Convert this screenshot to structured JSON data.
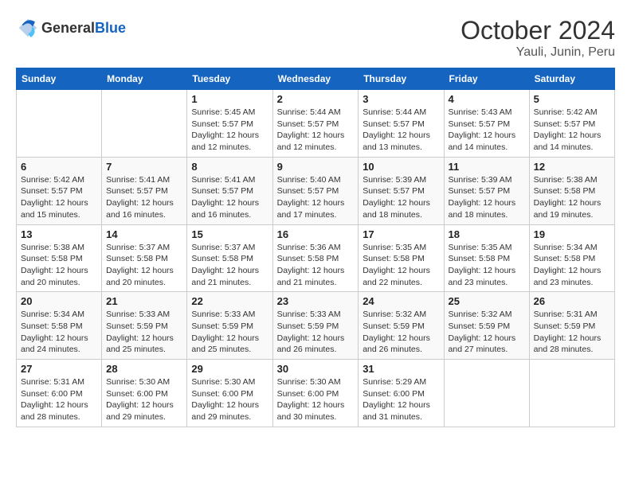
{
  "header": {
    "logo_general": "General",
    "logo_blue": "Blue",
    "month": "October 2024",
    "location": "Yauli, Junin, Peru"
  },
  "weekdays": [
    "Sunday",
    "Monday",
    "Tuesday",
    "Wednesday",
    "Thursday",
    "Friday",
    "Saturday"
  ],
  "weeks": [
    [
      {
        "day": "",
        "sunrise": "",
        "sunset": "",
        "daylight": ""
      },
      {
        "day": "",
        "sunrise": "",
        "sunset": "",
        "daylight": ""
      },
      {
        "day": "1",
        "sunrise": "Sunrise: 5:45 AM",
        "sunset": "Sunset: 5:57 PM",
        "daylight": "Daylight: 12 hours and 12 minutes."
      },
      {
        "day": "2",
        "sunrise": "Sunrise: 5:44 AM",
        "sunset": "Sunset: 5:57 PM",
        "daylight": "Daylight: 12 hours and 12 minutes."
      },
      {
        "day": "3",
        "sunrise": "Sunrise: 5:44 AM",
        "sunset": "Sunset: 5:57 PM",
        "daylight": "Daylight: 12 hours and 13 minutes."
      },
      {
        "day": "4",
        "sunrise": "Sunrise: 5:43 AM",
        "sunset": "Sunset: 5:57 PM",
        "daylight": "Daylight: 12 hours and 14 minutes."
      },
      {
        "day": "5",
        "sunrise": "Sunrise: 5:42 AM",
        "sunset": "Sunset: 5:57 PM",
        "daylight": "Daylight: 12 hours and 14 minutes."
      }
    ],
    [
      {
        "day": "6",
        "sunrise": "Sunrise: 5:42 AM",
        "sunset": "Sunset: 5:57 PM",
        "daylight": "Daylight: 12 hours and 15 minutes."
      },
      {
        "day": "7",
        "sunrise": "Sunrise: 5:41 AM",
        "sunset": "Sunset: 5:57 PM",
        "daylight": "Daylight: 12 hours and 16 minutes."
      },
      {
        "day": "8",
        "sunrise": "Sunrise: 5:41 AM",
        "sunset": "Sunset: 5:57 PM",
        "daylight": "Daylight: 12 hours and 16 minutes."
      },
      {
        "day": "9",
        "sunrise": "Sunrise: 5:40 AM",
        "sunset": "Sunset: 5:57 PM",
        "daylight": "Daylight: 12 hours and 17 minutes."
      },
      {
        "day": "10",
        "sunrise": "Sunrise: 5:39 AM",
        "sunset": "Sunset: 5:57 PM",
        "daylight": "Daylight: 12 hours and 18 minutes."
      },
      {
        "day": "11",
        "sunrise": "Sunrise: 5:39 AM",
        "sunset": "Sunset: 5:57 PM",
        "daylight": "Daylight: 12 hours and 18 minutes."
      },
      {
        "day": "12",
        "sunrise": "Sunrise: 5:38 AM",
        "sunset": "Sunset: 5:58 PM",
        "daylight": "Daylight: 12 hours and 19 minutes."
      }
    ],
    [
      {
        "day": "13",
        "sunrise": "Sunrise: 5:38 AM",
        "sunset": "Sunset: 5:58 PM",
        "daylight": "Daylight: 12 hours and 20 minutes."
      },
      {
        "day": "14",
        "sunrise": "Sunrise: 5:37 AM",
        "sunset": "Sunset: 5:58 PM",
        "daylight": "Daylight: 12 hours and 20 minutes."
      },
      {
        "day": "15",
        "sunrise": "Sunrise: 5:37 AM",
        "sunset": "Sunset: 5:58 PM",
        "daylight": "Daylight: 12 hours and 21 minutes."
      },
      {
        "day": "16",
        "sunrise": "Sunrise: 5:36 AM",
        "sunset": "Sunset: 5:58 PM",
        "daylight": "Daylight: 12 hours and 21 minutes."
      },
      {
        "day": "17",
        "sunrise": "Sunrise: 5:35 AM",
        "sunset": "Sunset: 5:58 PM",
        "daylight": "Daylight: 12 hours and 22 minutes."
      },
      {
        "day": "18",
        "sunrise": "Sunrise: 5:35 AM",
        "sunset": "Sunset: 5:58 PM",
        "daylight": "Daylight: 12 hours and 23 minutes."
      },
      {
        "day": "19",
        "sunrise": "Sunrise: 5:34 AM",
        "sunset": "Sunset: 5:58 PM",
        "daylight": "Daylight: 12 hours and 23 minutes."
      }
    ],
    [
      {
        "day": "20",
        "sunrise": "Sunrise: 5:34 AM",
        "sunset": "Sunset: 5:58 PM",
        "daylight": "Daylight: 12 hours and 24 minutes."
      },
      {
        "day": "21",
        "sunrise": "Sunrise: 5:33 AM",
        "sunset": "Sunset: 5:59 PM",
        "daylight": "Daylight: 12 hours and 25 minutes."
      },
      {
        "day": "22",
        "sunrise": "Sunrise: 5:33 AM",
        "sunset": "Sunset: 5:59 PM",
        "daylight": "Daylight: 12 hours and 25 minutes."
      },
      {
        "day": "23",
        "sunrise": "Sunrise: 5:33 AM",
        "sunset": "Sunset: 5:59 PM",
        "daylight": "Daylight: 12 hours and 26 minutes."
      },
      {
        "day": "24",
        "sunrise": "Sunrise: 5:32 AM",
        "sunset": "Sunset: 5:59 PM",
        "daylight": "Daylight: 12 hours and 26 minutes."
      },
      {
        "day": "25",
        "sunrise": "Sunrise: 5:32 AM",
        "sunset": "Sunset: 5:59 PM",
        "daylight": "Daylight: 12 hours and 27 minutes."
      },
      {
        "day": "26",
        "sunrise": "Sunrise: 5:31 AM",
        "sunset": "Sunset: 5:59 PM",
        "daylight": "Daylight: 12 hours and 28 minutes."
      }
    ],
    [
      {
        "day": "27",
        "sunrise": "Sunrise: 5:31 AM",
        "sunset": "Sunset: 6:00 PM",
        "daylight": "Daylight: 12 hours and 28 minutes."
      },
      {
        "day": "28",
        "sunrise": "Sunrise: 5:30 AM",
        "sunset": "Sunset: 6:00 PM",
        "daylight": "Daylight: 12 hours and 29 minutes."
      },
      {
        "day": "29",
        "sunrise": "Sunrise: 5:30 AM",
        "sunset": "Sunset: 6:00 PM",
        "daylight": "Daylight: 12 hours and 29 minutes."
      },
      {
        "day": "30",
        "sunrise": "Sunrise: 5:30 AM",
        "sunset": "Sunset: 6:00 PM",
        "daylight": "Daylight: 12 hours and 30 minutes."
      },
      {
        "day": "31",
        "sunrise": "Sunrise: 5:29 AM",
        "sunset": "Sunset: 6:00 PM",
        "daylight": "Daylight: 12 hours and 31 minutes."
      },
      {
        "day": "",
        "sunrise": "",
        "sunset": "",
        "daylight": ""
      },
      {
        "day": "",
        "sunrise": "",
        "sunset": "",
        "daylight": ""
      }
    ]
  ]
}
